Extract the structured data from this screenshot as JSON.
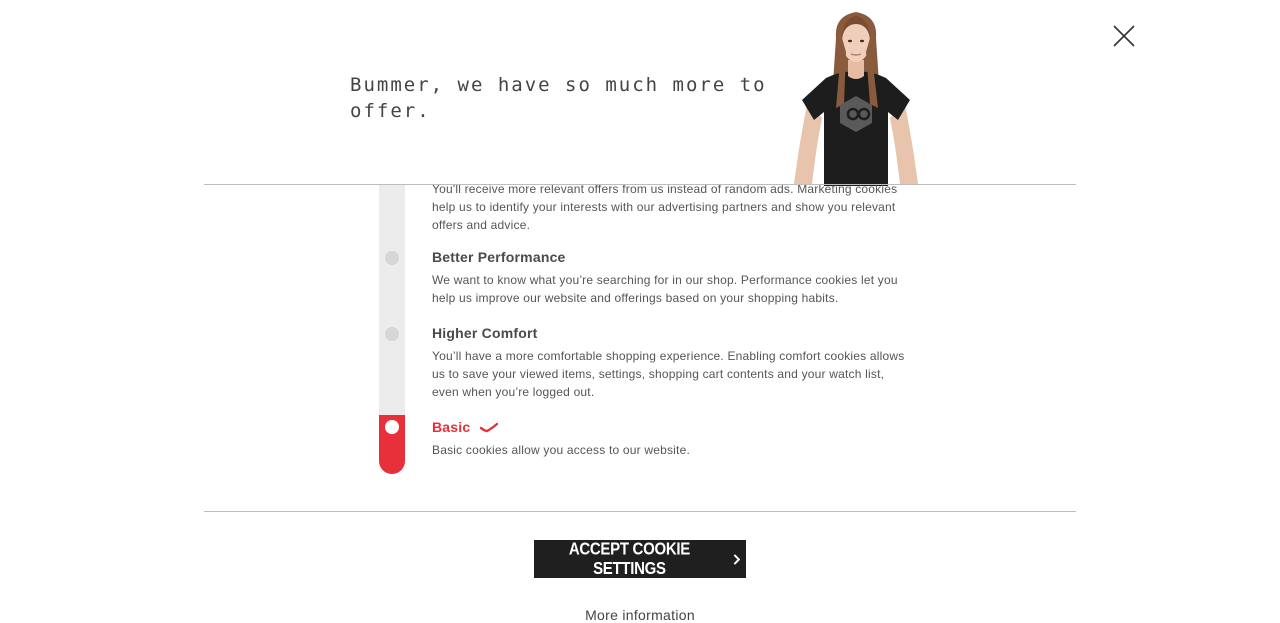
{
  "dialog": {
    "headline": "Bummer, we have so much more to offer.",
    "close_label": "Close"
  },
  "levels": [
    {
      "title": "",
      "description": "You'll receive more relevant offers from us instead of random ads. Marketing cookies help us to identify your interests with our advertising partners and show you relevant offers and advice.",
      "active": false
    },
    {
      "title": "Better Performance",
      "description": "We want to know what you’re searching for in our shop. Performance cookies let you help us improve our website and offerings based on your shopping habits.",
      "active": false
    },
    {
      "title": "Higher Comfort",
      "description": "You’ll have a more comfortable shopping experience. Enabling comfort cookies allows us to save your viewed items, settings, shopping cart contents and your watch list, even when you’re logged out.",
      "active": false
    },
    {
      "title": "Basic",
      "description": "Basic cookies allow you access to our website.",
      "active": true
    }
  ],
  "actions": {
    "accept_label": "ACCEPT COOKIE SETTINGS",
    "more_info_label": "More information"
  },
  "colors": {
    "accent": "#e8303a",
    "button_bg": "#1f1f1f",
    "track": "#ececec"
  },
  "icons": {
    "close": "close-icon",
    "check": "check-icon",
    "chevron": "chevron-right-icon"
  }
}
